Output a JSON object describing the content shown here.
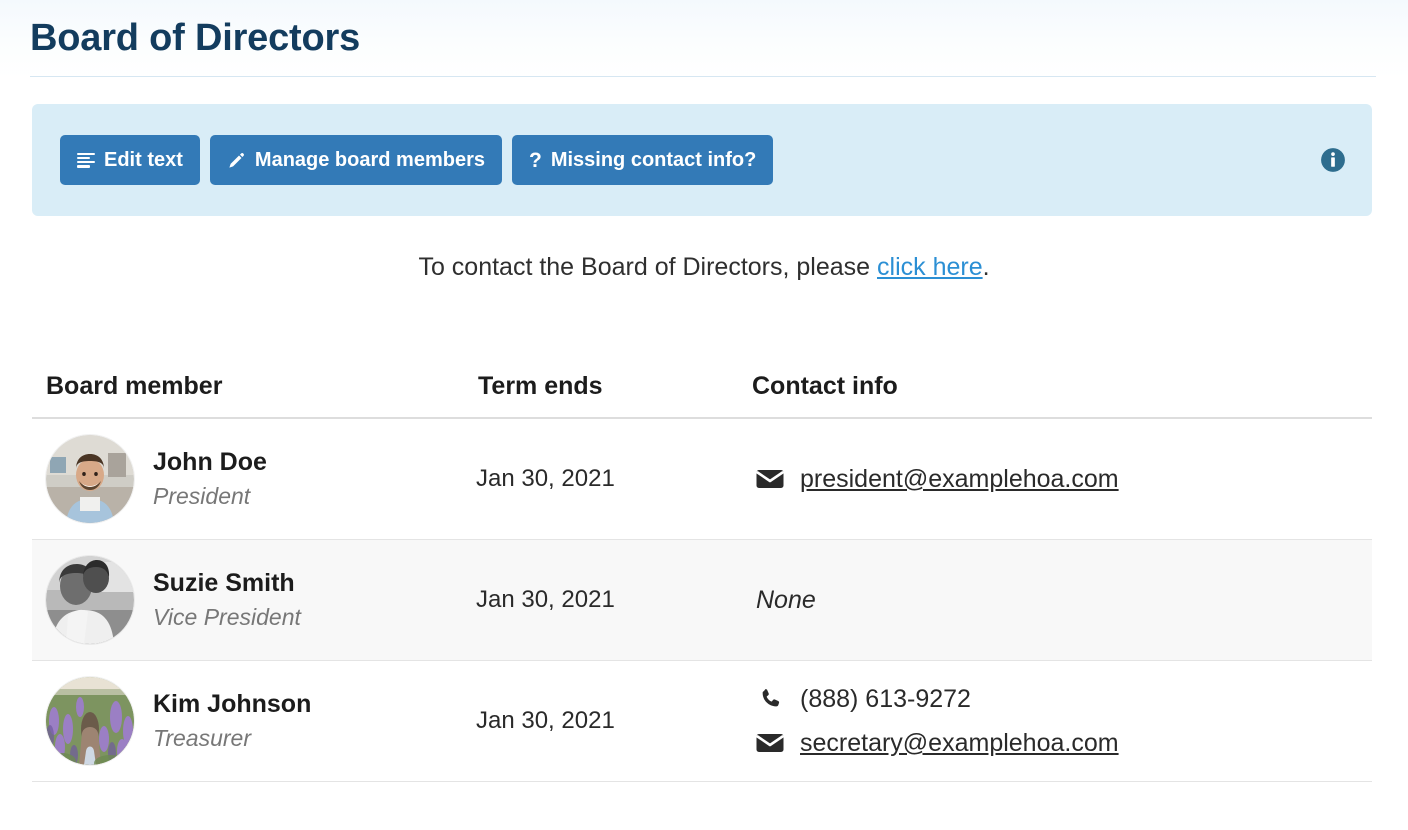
{
  "header": {
    "title": "Board of Directors"
  },
  "toolbar": {
    "buttons": [
      {
        "label": "Edit text",
        "icon": "list-lines-icon"
      },
      {
        "label": "Manage board members",
        "icon": "pencil-icon"
      },
      {
        "label": "Missing contact info?",
        "icon": "question-mark-icon"
      }
    ],
    "info_icon": "info-circle-icon",
    "background_color": "#d9edf7",
    "button_color": "#337ab7"
  },
  "intro": {
    "text_before": "To contact the Board of Directors, please ",
    "link_text": "click here",
    "text_after": ".",
    "link_color": "#2b8fd4"
  },
  "table": {
    "columns": [
      "Board member",
      "Term ends",
      "Contact info"
    ],
    "rows": [
      {
        "name": "John Doe",
        "role": "President",
        "avatar": "photo-man-blue-shirt",
        "term_ends": "Jan 30, 2021",
        "contacts": [
          {
            "type": "email",
            "icon": "envelope-icon",
            "value": "president@examplehoa.com"
          }
        ]
      },
      {
        "name": "Suzie Smith",
        "role": "Vice President",
        "avatar": "photo-grayscale-couple",
        "term_ends": "Jan 30, 2021",
        "contacts": [
          {
            "type": "none",
            "icon": "",
            "value": "None"
          }
        ]
      },
      {
        "name": "Kim Johnson",
        "role": "Treasurer",
        "avatar": "photo-lavender-field",
        "term_ends": "Jan 30, 2021",
        "contacts": [
          {
            "type": "phone",
            "icon": "phone-icon",
            "value": "(888) 613-9272"
          },
          {
            "type": "email",
            "icon": "envelope-icon",
            "value": "secretary@examplehoa.com"
          }
        ]
      }
    ]
  }
}
